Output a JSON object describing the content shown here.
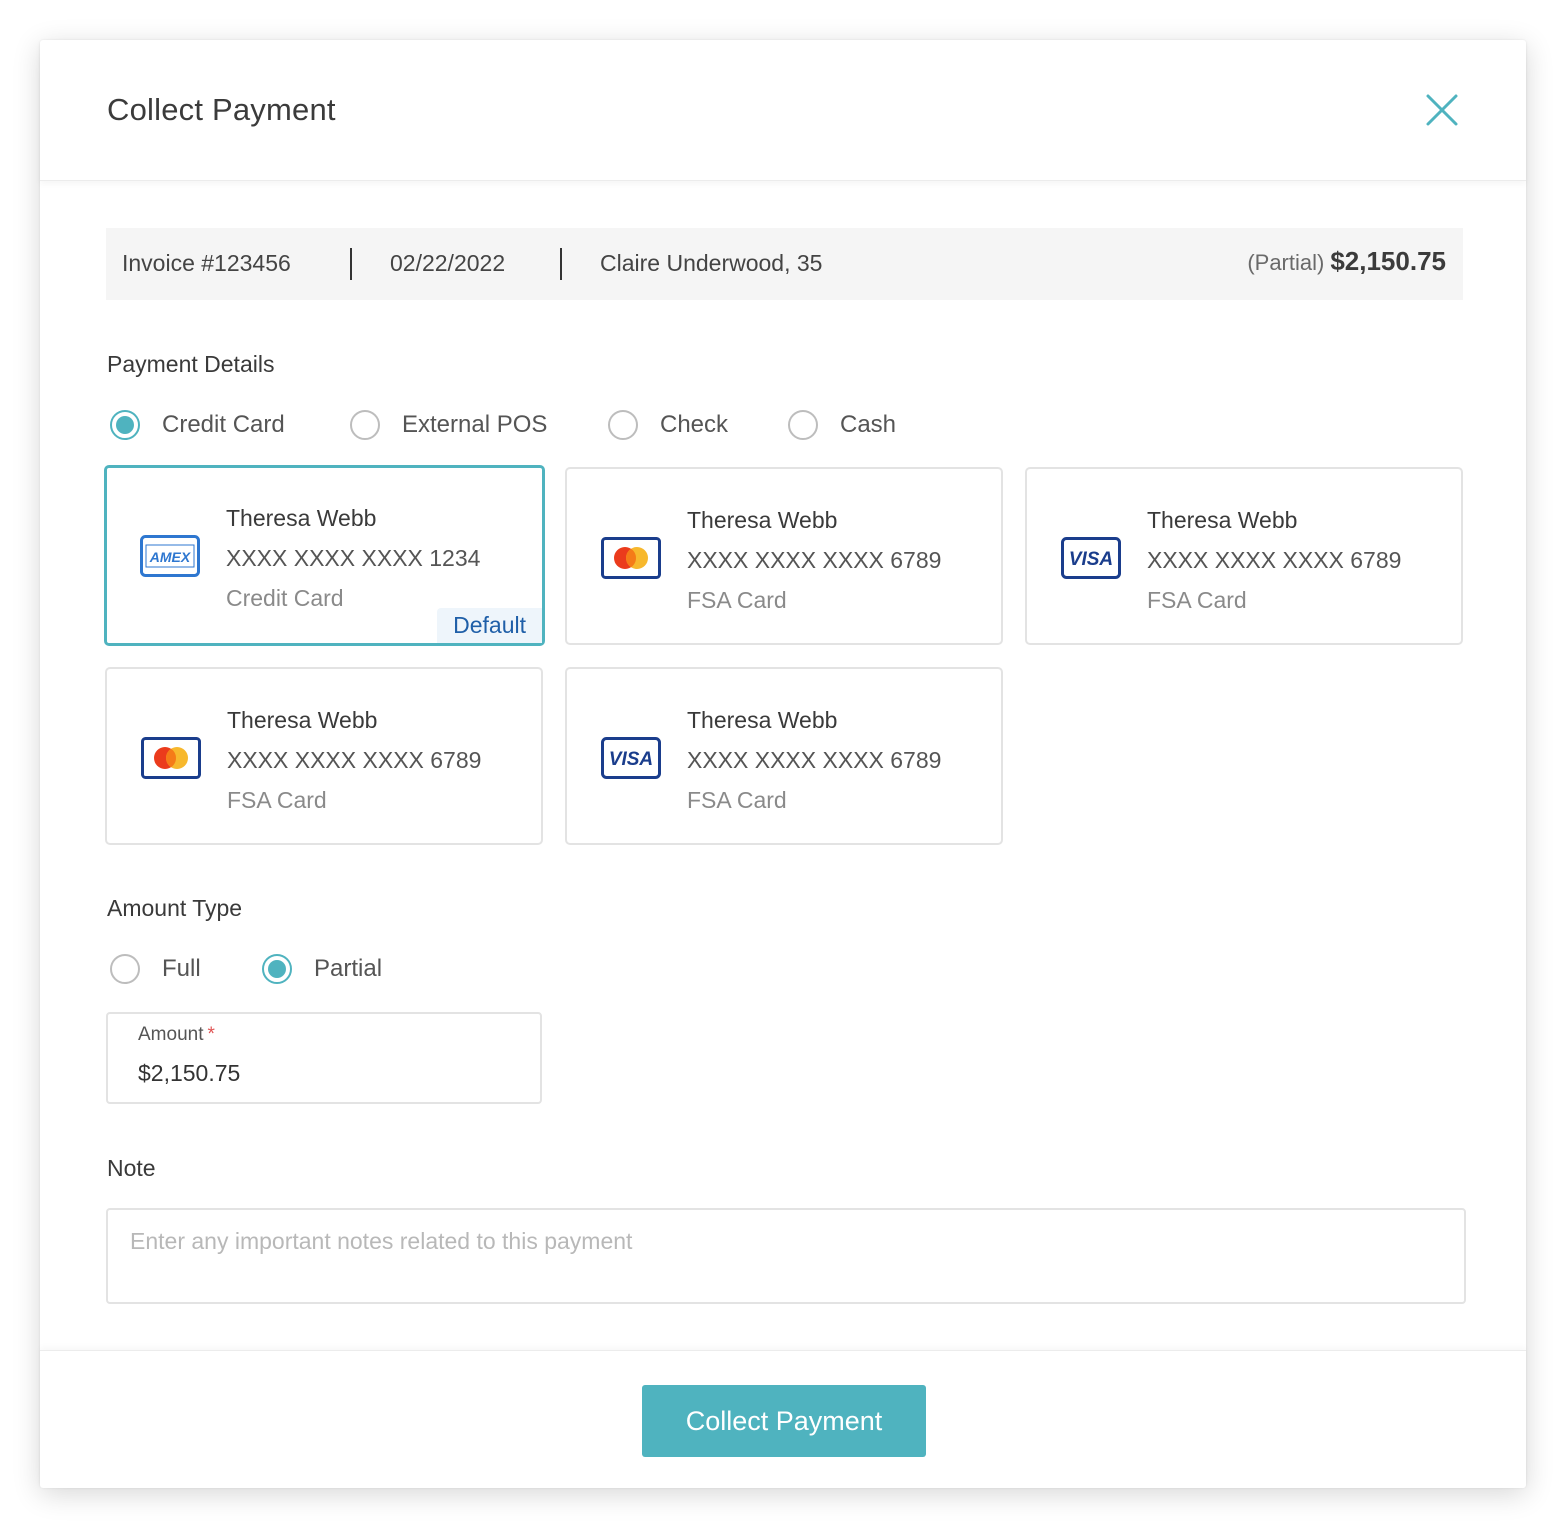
{
  "modal": {
    "title": "Collect Payment"
  },
  "invoice": {
    "number": "Invoice #123456",
    "date": "02/22/2022",
    "patient": "Claire Underwood, 35",
    "amount_type": "(Partial)",
    "amount": "$2,150.75"
  },
  "payment_details": {
    "label": "Payment Details",
    "methods": [
      {
        "label": "Credit Card",
        "selected": true
      },
      {
        "label": "External POS",
        "selected": false
      },
      {
        "label": "Check",
        "selected": false
      },
      {
        "label": "Cash",
        "selected": false
      }
    ]
  },
  "cards": [
    {
      "brand": "amex",
      "name": "Theresa Webb",
      "number": "XXXX XXXX XXXX 1234",
      "type": "Credit Card",
      "selected": true,
      "badge": "Default"
    },
    {
      "brand": "mastercard",
      "name": "Theresa Webb",
      "number": "XXXX XXXX XXXX 6789",
      "type": "FSA Card",
      "selected": false
    },
    {
      "brand": "visa",
      "name": "Theresa Webb",
      "number": "XXXX XXXX XXXX 6789",
      "type": "FSA Card",
      "selected": false
    },
    {
      "brand": "mastercard",
      "name": "Theresa Webb",
      "number": "XXXX XXXX XXXX 6789",
      "type": "FSA Card",
      "selected": false
    },
    {
      "brand": "visa",
      "name": "Theresa Webb",
      "number": "XXXX XXXX XXXX 6789",
      "type": "FSA Card",
      "selected": false
    }
  ],
  "amount_type": {
    "label": "Amount Type",
    "options": [
      {
        "label": "Full",
        "selected": false
      },
      {
        "label": "Partial",
        "selected": true
      }
    ]
  },
  "amount_field": {
    "label": "Amount",
    "required_mark": "*",
    "value": "$2,150.75"
  },
  "note": {
    "label": "Note",
    "placeholder": "Enter any important notes related to this payment",
    "value": ""
  },
  "footer": {
    "submit_label": "Collect Payment"
  },
  "colors": {
    "accent": "#4fb3bf",
    "badge_text": "#1f5fa8",
    "required": "#e05353"
  },
  "logo_text": {
    "amex": "AMEX",
    "visa": "VISA"
  }
}
